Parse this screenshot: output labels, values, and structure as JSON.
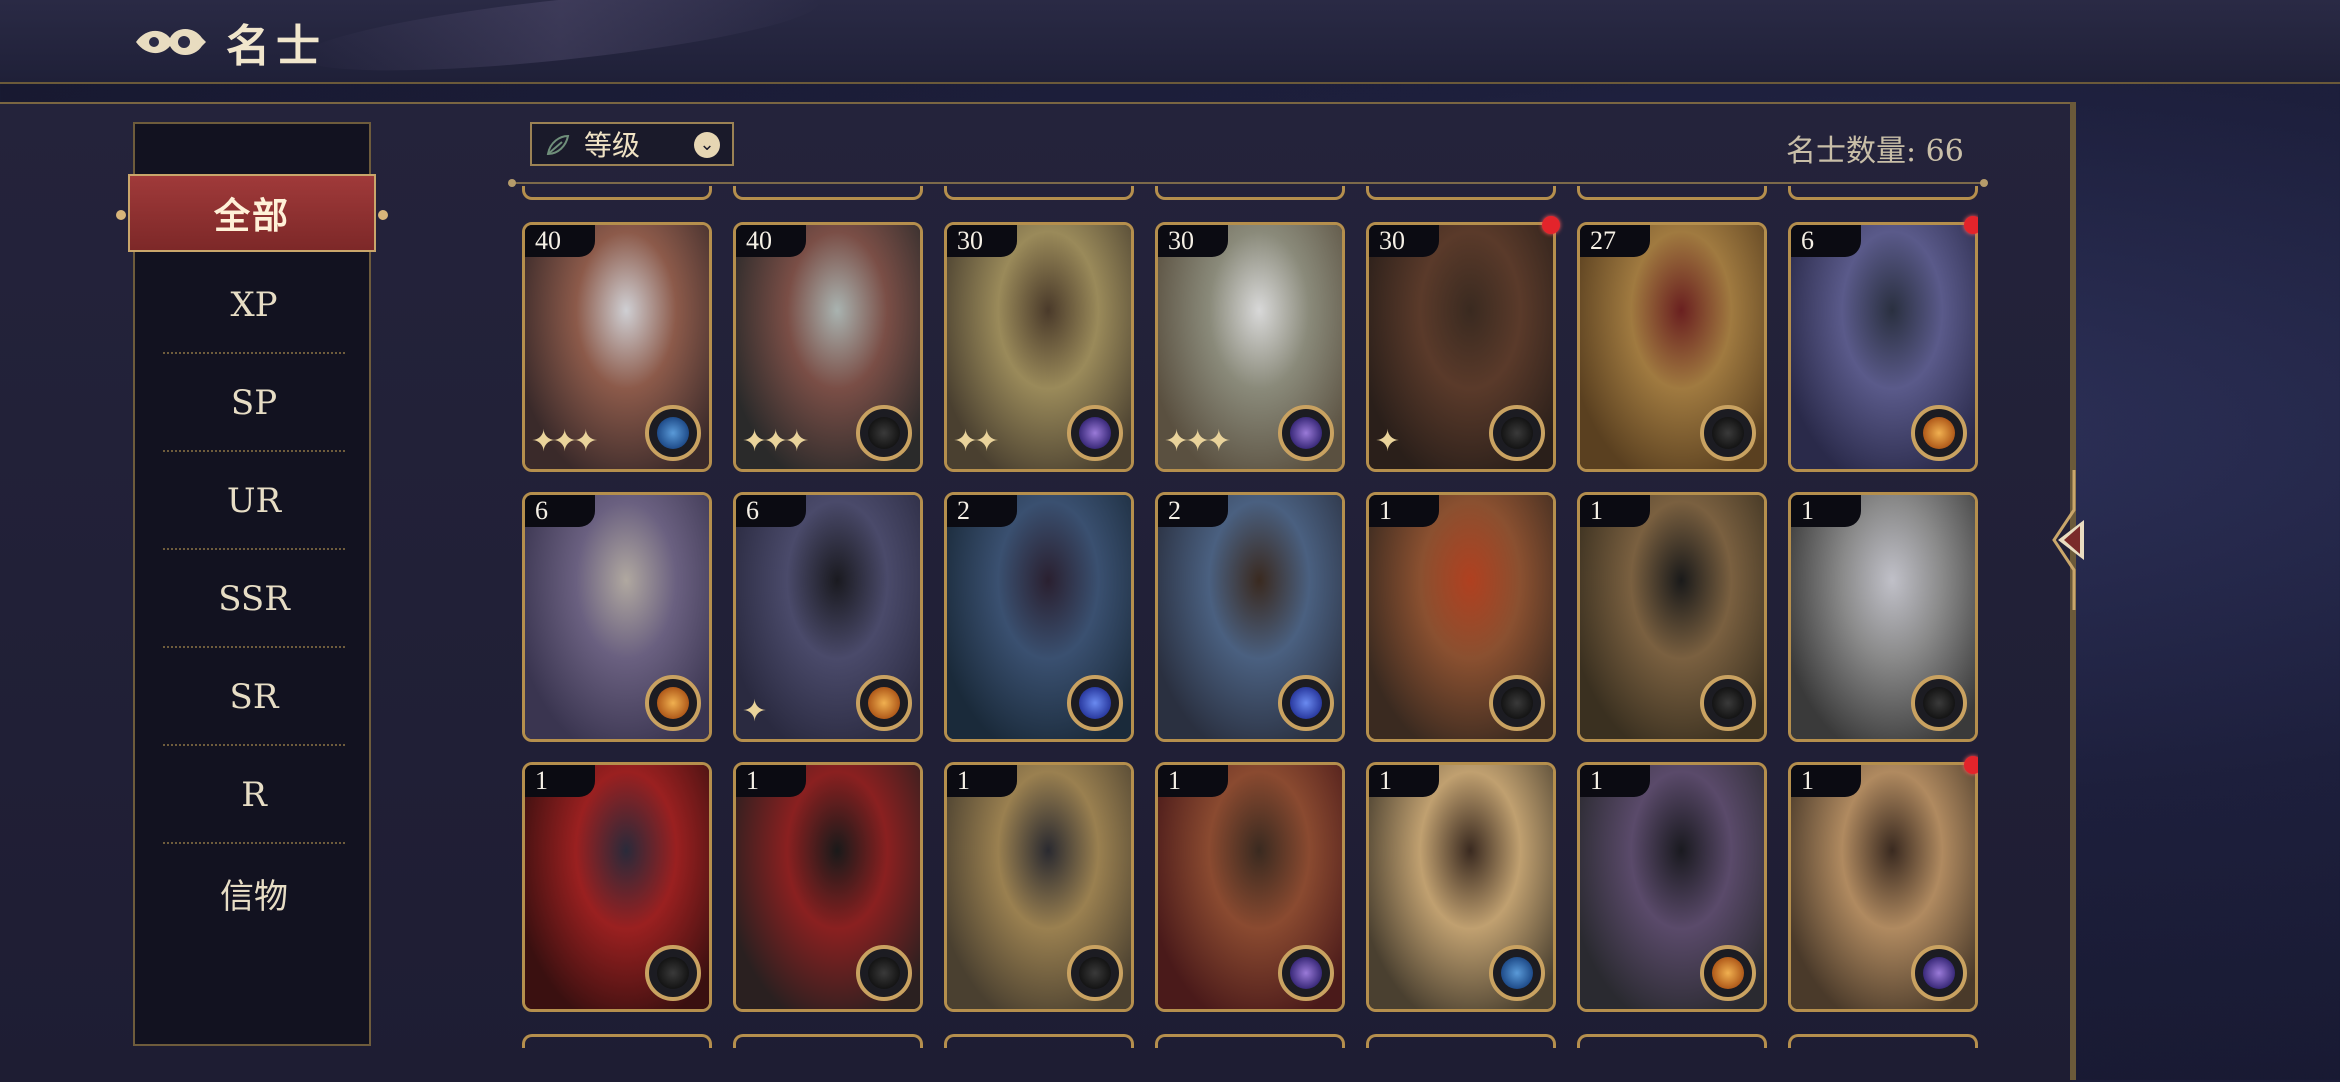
{
  "header": {
    "title": "名士"
  },
  "sidebar": {
    "active": "全部",
    "items": [
      "XP",
      "SP",
      "UR",
      "SSR",
      "SR",
      "R",
      "信物"
    ]
  },
  "toolbar": {
    "sort_label": "等级",
    "count_text": "名士数量: 66"
  },
  "cards": [
    {
      "level": "40",
      "red_dot": false,
      "badge": "blue-compass",
      "stars": "✦✦✦",
      "art": [
        "#3a2a2a",
        "#8c5a4a",
        "#cfcfd3"
      ]
    },
    {
      "level": "40",
      "red_dot": false,
      "badge": "gold-compass",
      "stars": "✦✦✦",
      "art": [
        "#2a2a2a",
        "#7a4e46",
        "#a9b3b0"
      ]
    },
    {
      "level": "30",
      "red_dot": false,
      "badge": "purple-planet",
      "stars": "✦✦",
      "art": [
        "#4a4030",
        "#9a8a5a",
        "#4a3a2a"
      ]
    },
    {
      "level": "30",
      "red_dot": false,
      "badge": "purple-planet",
      "stars": "✦✦✦",
      "art": [
        "#5a5040",
        "#8a8a7a",
        "#d8d8d8"
      ]
    },
    {
      "level": "30",
      "red_dot": true,
      "badge": "gold-compass",
      "stars": "✦",
      "art": [
        "#2a1f1a",
        "#5a3a2a",
        "#3a2a20"
      ]
    },
    {
      "level": "27",
      "red_dot": false,
      "badge": "gold-compass",
      "stars": "",
      "art": [
        "#5a4020",
        "#a07a40",
        "#6a2020"
      ]
    },
    {
      "level": "6",
      "red_dot": true,
      "badge": "orange-orb",
      "stars": "",
      "art": [
        "#2a2a4a",
        "#5a5a8a",
        "#2a3040"
      ]
    },
    {
      "level": "6",
      "red_dot": false,
      "badge": "orange-orb",
      "stars": "",
      "art": [
        "#3a3550",
        "#6a6080",
        "#b0a8a0"
      ]
    },
    {
      "level": "6",
      "red_dot": false,
      "badge": "orange-orb",
      "stars": "✦",
      "art": [
        "#2a2a40",
        "#4a4a6a",
        "#1a1a20"
      ]
    },
    {
      "level": "2",
      "red_dot": false,
      "badge": "blue-planet",
      "stars": "",
      "art": [
        "#1a2a3a",
        "#3a5070",
        "#2a2030"
      ]
    },
    {
      "level": "2",
      "red_dot": false,
      "badge": "blue-planet",
      "stars": "",
      "art": [
        "#2a3040",
        "#4a6080",
        "#3a2a20"
      ]
    },
    {
      "level": "1",
      "red_dot": false,
      "badge": "gold-compass",
      "stars": "",
      "art": [
        "#3a2a20",
        "#8a5030",
        "#b04020"
      ]
    },
    {
      "level": "1",
      "red_dot": false,
      "badge": "gold-compass",
      "stars": "",
      "art": [
        "#3a3020",
        "#7a6040",
        "#1a1a1a"
      ]
    },
    {
      "level": "1",
      "red_dot": false,
      "badge": "gold-compass",
      "stars": "",
      "art": [
        "#3a3a3a",
        "#8a8a8a",
        "#c0c0c8"
      ]
    },
    {
      "level": "1",
      "red_dot": false,
      "badge": "gold-compass",
      "stars": "",
      "art": [
        "#3a1010",
        "#9a2020",
        "#2a2a3a"
      ]
    },
    {
      "level": "1",
      "red_dot": false,
      "badge": "gold-compass",
      "stars": "",
      "art": [
        "#2a2020",
        "#8a2020",
        "#1a1a1a"
      ]
    },
    {
      "level": "1",
      "red_dot": false,
      "badge": "gold-compass",
      "stars": "",
      "art": [
        "#4a4030",
        "#9a8050",
        "#2a2a30"
      ]
    },
    {
      "level": "1",
      "red_dot": false,
      "badge": "purple-planet",
      "stars": "",
      "art": [
        "#4a1a1a",
        "#8a4a30",
        "#3a2a20"
      ]
    },
    {
      "level": "1",
      "red_dot": false,
      "badge": "blue-compass",
      "stars": "",
      "art": [
        "#4a4030",
        "#c0a070",
        "#3a2a20"
      ]
    },
    {
      "level": "1",
      "red_dot": false,
      "badge": "orange-orb",
      "stars": "",
      "art": [
        "#2a2a30",
        "#5a4a6a",
        "#1a1a20"
      ]
    },
    {
      "level": "1",
      "red_dot": true,
      "badge": "purple-planet",
      "stars": "",
      "art": [
        "#4a3a2a",
        "#b08a60",
        "#3a2a20"
      ]
    }
  ],
  "colors": {
    "accent_gold": "#b58f4d",
    "active_red": "#8f3030",
    "notification_red": "#e3242b",
    "background_navy": "#1d1f3c"
  }
}
